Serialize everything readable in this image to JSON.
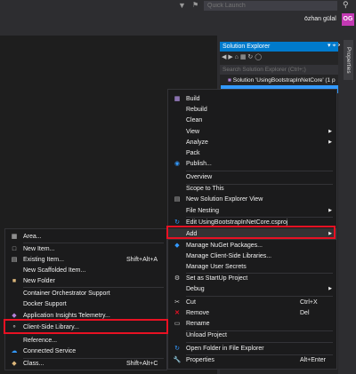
{
  "topbar": {
    "quick_launch_placeholder": "Quick Launch",
    "user_name": "özhan gülal",
    "user_initials": "OG"
  },
  "solution_explorer": {
    "title": "Solution Explorer",
    "search_placeholder": "Search Solution Explorer (Ctrl+;)",
    "solution_label": "Solution 'UsingBootstrapInNetCore' (1 p",
    "properties_tab": "Properties"
  },
  "context_menu": {
    "items": [
      {
        "label": "Build",
        "icon": "build-icon"
      },
      {
        "label": "Rebuild"
      },
      {
        "label": "Clean"
      },
      {
        "label": "View",
        "submenu": true
      },
      {
        "label": "Analyze",
        "submenu": true
      },
      {
        "label": "Pack"
      },
      {
        "label": "Publish...",
        "icon": "globe-icon"
      },
      {
        "label": "Overview"
      },
      {
        "label": "Scope to This"
      },
      {
        "label": "New Solution Explorer View",
        "icon": "explorer-view-icon"
      },
      {
        "label": "File Nesting",
        "submenu": true
      },
      {
        "label": "Edit UsingBootstrapInNetCore.csproj",
        "icon": "edit-project-icon"
      },
      {
        "label": "Add",
        "submenu": true
      },
      {
        "label": "Manage NuGet Packages...",
        "icon": "nuget-icon"
      },
      {
        "label": "Manage Client-Side Libraries..."
      },
      {
        "label": "Manage User Secrets"
      },
      {
        "label": "Set as StartUp Project",
        "icon": "gear-icon"
      },
      {
        "label": "Debug",
        "submenu": true
      },
      {
        "label": "Cut",
        "shortcut": "Ctrl+X",
        "icon": "scissors-icon"
      },
      {
        "label": "Remove",
        "shortcut": "Del",
        "icon": "remove-x-icon"
      },
      {
        "label": "Rename",
        "icon": "rename-icon"
      },
      {
        "label": "Unload Project"
      },
      {
        "label": "Open Folder in File Explorer",
        "icon": "folder-open-icon"
      },
      {
        "label": "Properties",
        "shortcut": "Alt+Enter",
        "icon": "wrench-icon"
      }
    ]
  },
  "add_submenu": {
    "items": [
      {
        "label": "Area...",
        "icon": "area-icon"
      },
      {
        "label": "New Item...",
        "icon": "new-item-icon"
      },
      {
        "label": "Existing Item...",
        "shortcut": "Shift+Alt+A",
        "icon": "existing-item-icon"
      },
      {
        "label": "New Scaffolded Item..."
      },
      {
        "label": "New Folder",
        "icon": "new-folder-icon"
      },
      {
        "label": "Container Orchestrator Support"
      },
      {
        "label": "Docker Support"
      },
      {
        "label": "Application Insights Telemetry...",
        "icon": "insights-icon"
      },
      {
        "label": "Client-Side Library...",
        "icon": "client-library-icon"
      },
      {
        "label": "Reference..."
      },
      {
        "label": "Connected Service",
        "icon": "connected-service-icon"
      },
      {
        "label": "Class...",
        "shortcut": "Shift+Alt+C",
        "icon": "class-icon"
      }
    ]
  },
  "colors": {
    "accent": "#007acc",
    "highlight_box": "#e81123",
    "avatar": "#c239b3"
  }
}
